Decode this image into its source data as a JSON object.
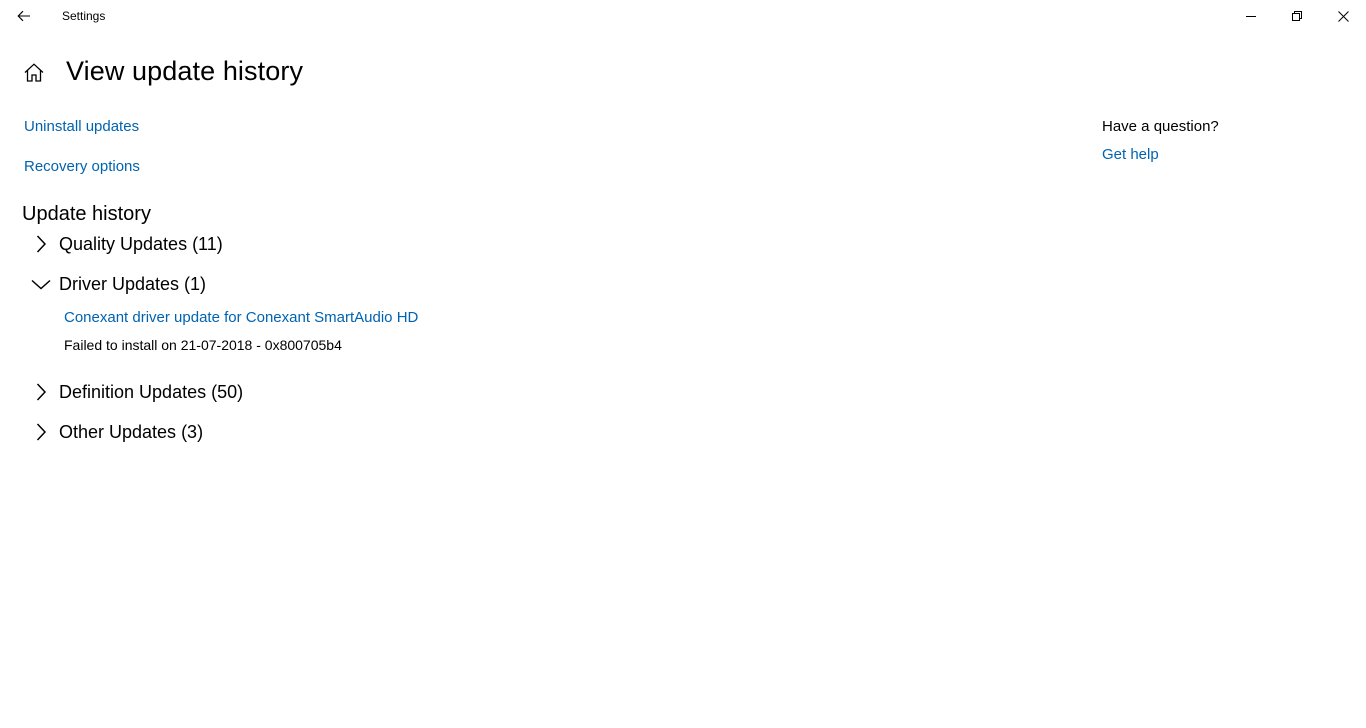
{
  "window": {
    "app_title": "Settings",
    "back_icon": "back-arrow-icon",
    "controls": {
      "minimize_icon": "minimize-icon",
      "maximize_icon": "restore-icon",
      "close_icon": "close-icon"
    }
  },
  "header": {
    "home_icon": "home-icon",
    "title": "View update history"
  },
  "links": {
    "uninstall": "Uninstall updates",
    "recovery": "Recovery options"
  },
  "help_panel": {
    "heading": "Have a question?",
    "link": "Get help"
  },
  "update_history": {
    "heading": "Update history",
    "groups": [
      {
        "label": "Quality Updates (11)",
        "expanded": false
      },
      {
        "label": "Driver Updates (1)",
        "expanded": true,
        "items": [
          {
            "title": "Conexant driver update for Conexant SmartAudio HD",
            "status": "Failed to install on 21-07-2018 - 0x800705b4"
          }
        ]
      },
      {
        "label": "Definition Updates (50)",
        "expanded": false
      },
      {
        "label": "Other Updates (3)",
        "expanded": false
      }
    ]
  },
  "colors": {
    "link": "#0063b1",
    "text": "#000000",
    "background": "#ffffff"
  }
}
